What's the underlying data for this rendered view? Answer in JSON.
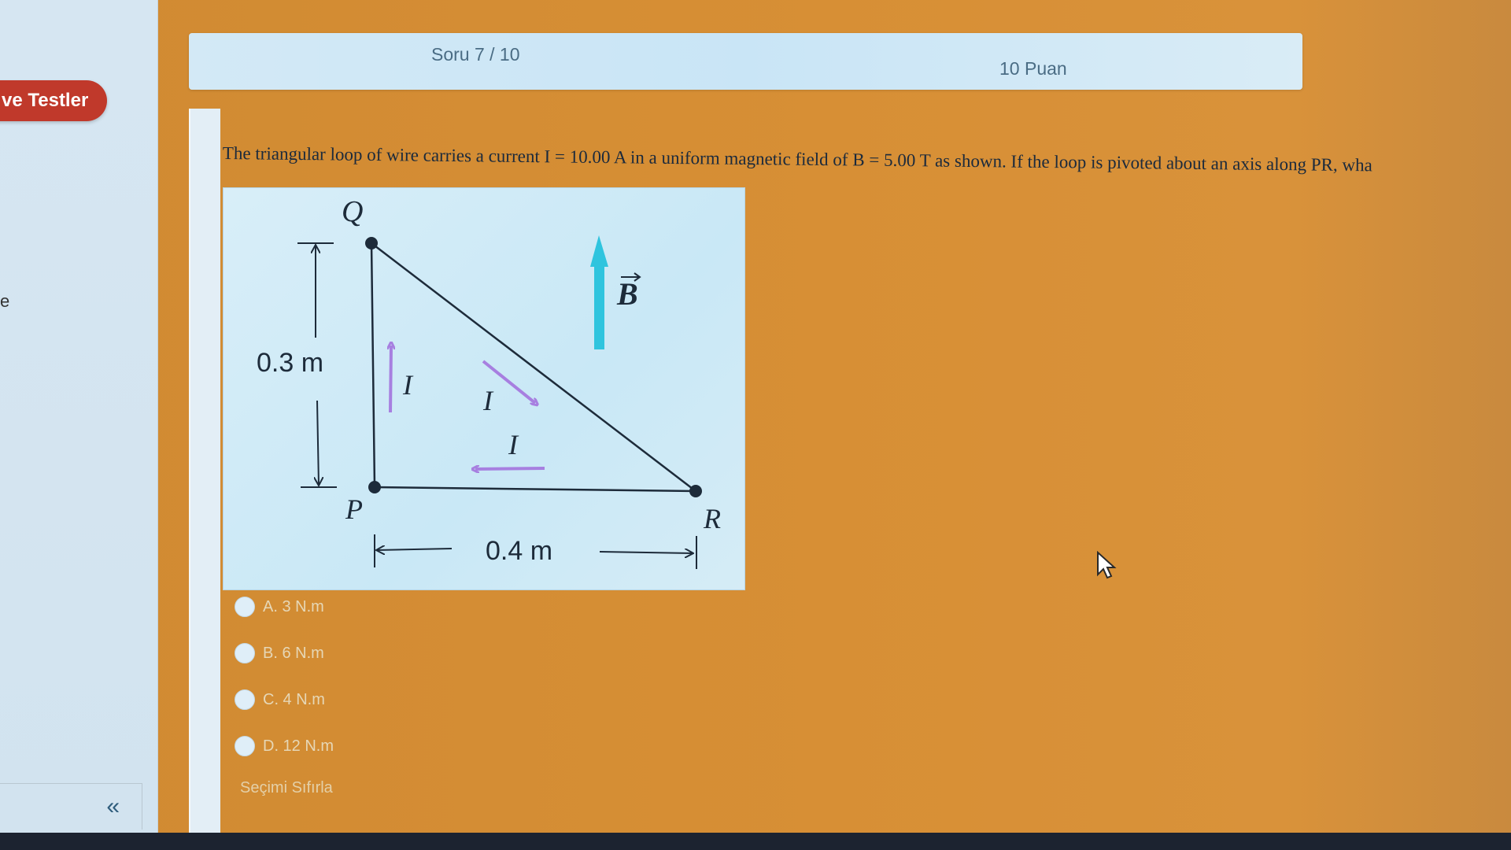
{
  "sidebar": {
    "badge_label": "ve Testler",
    "fragment_text": "e",
    "collapse_label": "«"
  },
  "header": {
    "question_counter": "Soru 7 / 10",
    "points": "10 Puan"
  },
  "question": {
    "text": "The triangular loop of wire carries a current I = 10.00 A in a uniform magnetic field of B = 5.00 T as shown.  If the loop is pivoted about an axis along PR, wha"
  },
  "figure": {
    "vertex_q": "Q",
    "vertex_p": "P",
    "vertex_r": "R",
    "height_label": "0.3 m",
    "width_label": "0.4 m",
    "current_label_1": "I",
    "current_label_2": "I",
    "current_label_3": "I",
    "field_label": "B",
    "colors": {
      "field_arrow": "#2fc4de",
      "current_arrow": "#a77fe0",
      "wire": "#1d2b3a"
    }
  },
  "options": [
    {
      "label": "A. 3 N.m"
    },
    {
      "label": "B. 6 N.m"
    },
    {
      "label": "C. 4 N.m"
    },
    {
      "label": "D. 12 N.m"
    }
  ],
  "clear_choice_label": "Seçimi Sıfırla"
}
